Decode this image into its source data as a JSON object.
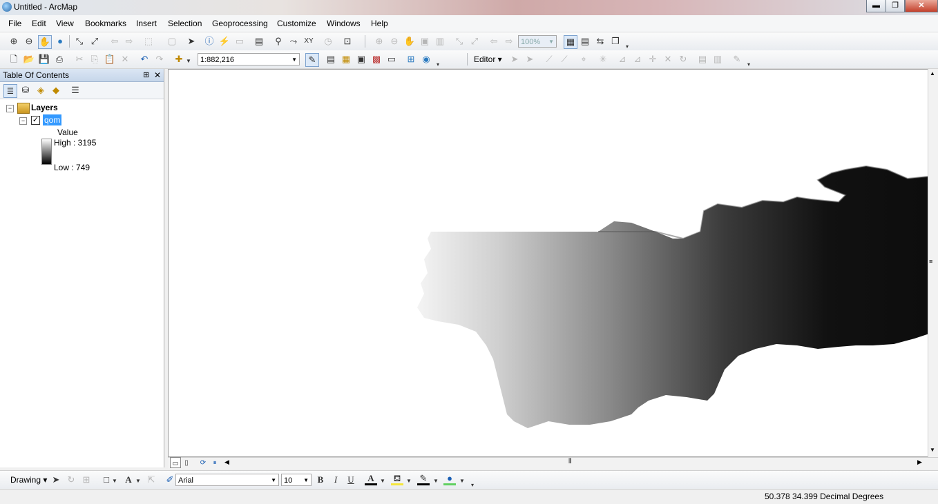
{
  "window": {
    "title": "Untitled - ArcMap",
    "minimize": "▬",
    "maximize": "❐",
    "close": "✕"
  },
  "menu": [
    "File",
    "Edit",
    "View",
    "Bookmarks",
    "Insert",
    "Selection",
    "Geoprocessing",
    "Customize",
    "Windows",
    "Help"
  ],
  "toolbar1": {
    "zoom_combo": "100%"
  },
  "toolbar2": {
    "scale": "1:882,216",
    "editor_label": "Editor ▾"
  },
  "toc": {
    "title": "Table Of Contents",
    "pin": "⊞",
    "close": "✕",
    "layers_label": "Layers",
    "layer_name": "qom",
    "legend_heading": "Value",
    "high_label": "High : 3195",
    "low_label": "Low : 749",
    "collapse_symbol": "−"
  },
  "drawing": {
    "label": "Drawing ▾",
    "font": "Arial",
    "size": "10",
    "bold": "B",
    "italic": "I",
    "underline": "U",
    "font_color_letter": "A"
  },
  "status": {
    "coordinates": "50.378  34.399 Decimal Degrees"
  },
  "colors": {
    "selection": "#3399ff",
    "toc_header": "#c6d6ea",
    "line_color": "#60d060"
  }
}
